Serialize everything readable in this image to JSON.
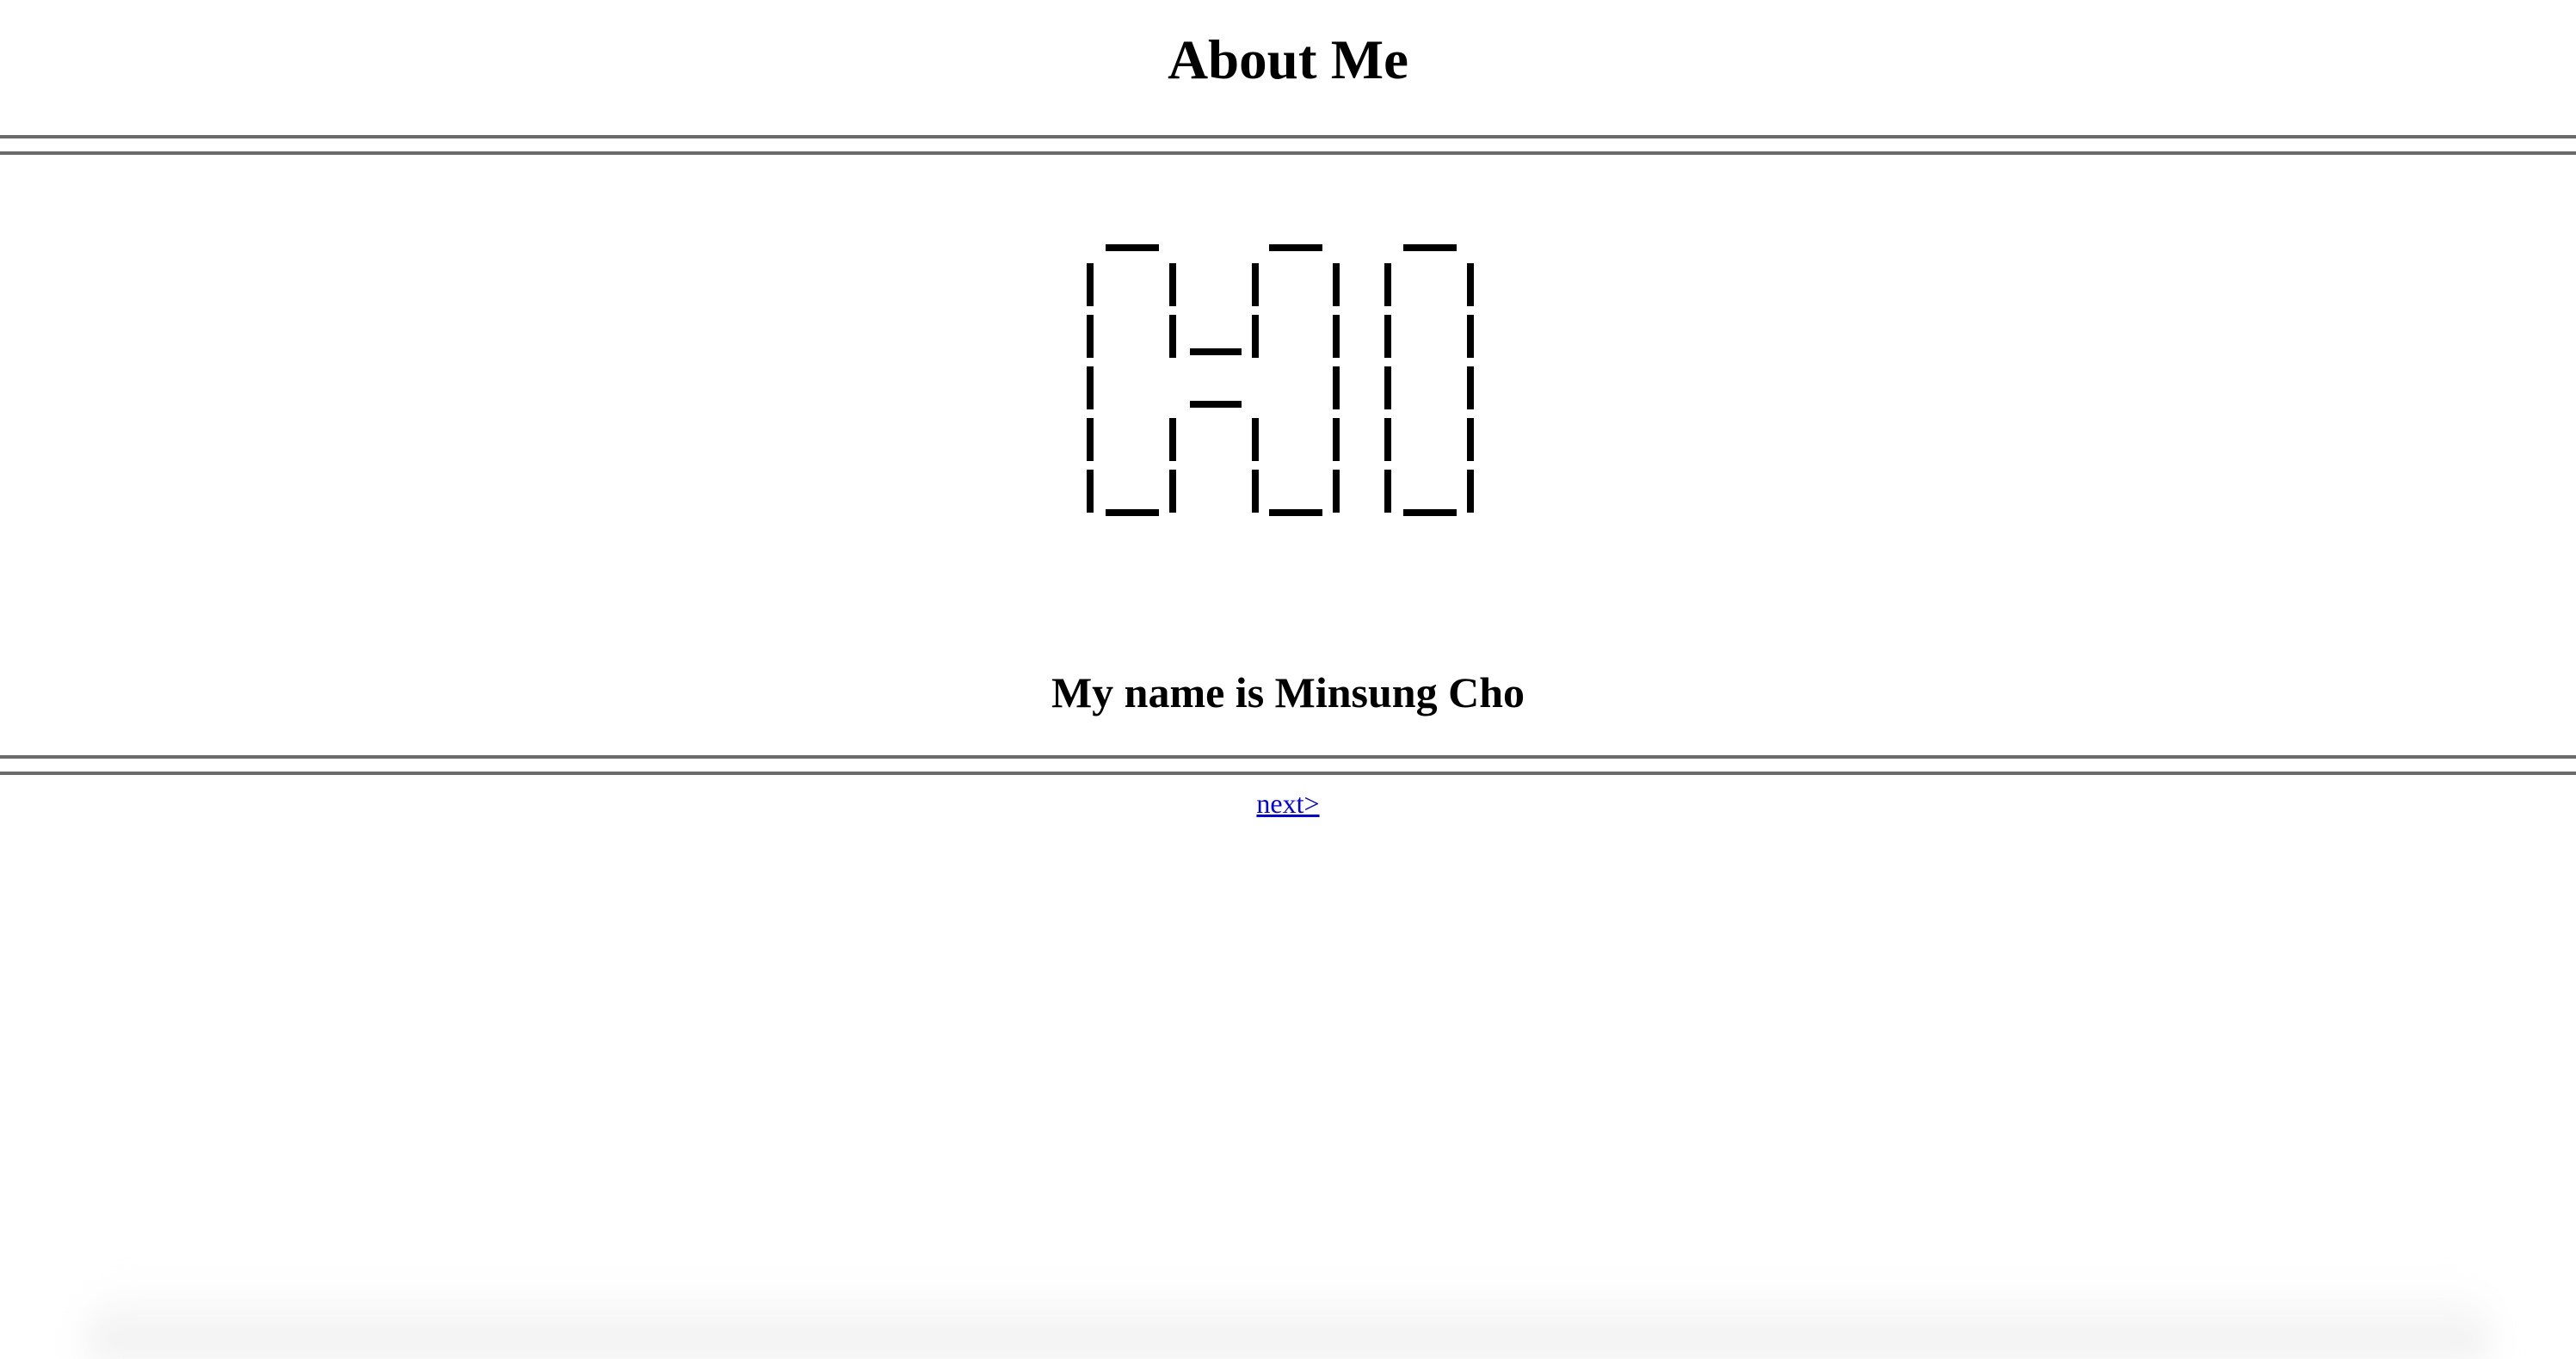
{
  "page": {
    "title": "About Me",
    "name_heading": "My name is Minsung Cho",
    "next_link": "next>",
    "ascii_art_text": "CHO",
    "link_color": "#0000ee",
    "rule_color": "#6a6a6a"
  }
}
